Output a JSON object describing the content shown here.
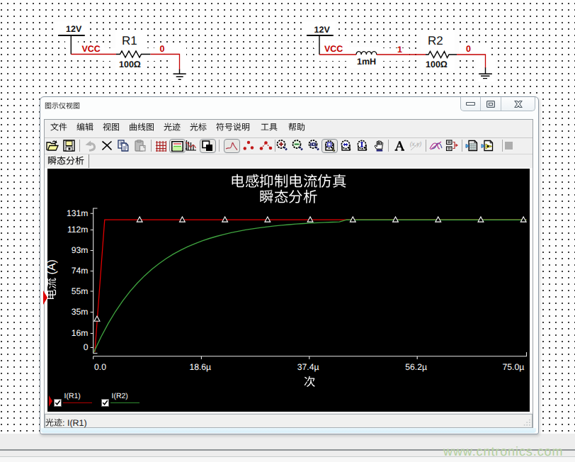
{
  "schematic": {
    "left": {
      "source_label": "12V",
      "net_vcc": "VCC",
      "refdes": "R1",
      "value": "100Ω",
      "net_out": "0"
    },
    "right": {
      "source_label": "12V",
      "net_vcc": "VCC",
      "inductor_value": "1mH",
      "net_mid": "1",
      "refdes": "R2",
      "value": "100Ω",
      "net_out": "0"
    }
  },
  "window": {
    "title": "图示仪视图",
    "controls": [
      {
        "name": "minimize"
      },
      {
        "name": "maximize"
      },
      {
        "name": "close"
      }
    ],
    "menu": [
      "文件",
      "编辑",
      "视图",
      "曲线图",
      "光迹",
      "光标",
      "符号说明",
      "工具",
      "帮助"
    ],
    "toolbar": [
      {
        "icon": "open",
        "sep": false
      },
      {
        "icon": "save",
        "sep": true
      },
      {
        "icon": "undo"
      },
      {
        "icon": "delete"
      },
      {
        "icon": "copy"
      },
      {
        "icon": "paste",
        "sep": true
      },
      {
        "icon": "grid"
      },
      {
        "icon": "legend",
        "pressed": true
      },
      {
        "icon": "traces"
      },
      {
        "icon": "bw",
        "pressed": true,
        "sep": true
      },
      {
        "icon": "curve",
        "pressed": true
      },
      {
        "icon": "dots"
      },
      {
        "icon": "dotline",
        "sep": true
      },
      {
        "icon": "zoomin"
      },
      {
        "icon": "zoomout"
      },
      {
        "icon": "zoom100"
      },
      {
        "icon": "zoomsel",
        "pressed": true
      },
      {
        "icon": "zoomh"
      },
      {
        "icon": "zoomv"
      },
      {
        "icon": "hand",
        "sep": true
      },
      {
        "icon": "text"
      },
      {
        "icon": "xy",
        "sep": true
      },
      {
        "icon": "overlay"
      },
      {
        "icon": "export",
        "sep": true
      },
      {
        "icon": "excel"
      },
      {
        "icon": "pagearrow",
        "sep": true
      },
      {
        "icon": "stop"
      }
    ],
    "tab": "瞬态分析",
    "statusbar": "光迹: I(R1)"
  },
  "chart_data": {
    "type": "line",
    "title": "电感抑制电流仿真",
    "subtitle": "瞬态分析",
    "xlabel": "次",
    "ylabel": "电流 (A)",
    "x_unit": "µs",
    "y_unit": "mA",
    "xlim": [
      0,
      75
    ],
    "ylim": [
      0,
      131.25
    ],
    "x_ticks": [
      "0.0",
      "18.6µ",
      "37.4µ",
      "56.2µ",
      "75.0µ"
    ],
    "y_ticks": [
      "0",
      "16m",
      "35m",
      "55m",
      "74m",
      "93m",
      "112m",
      "131m"
    ],
    "series": [
      {
        "name": "I(R1)",
        "color": "#e80000",
        "points": [
          [
            0.3,
            0
          ],
          [
            2.0,
            120.0
          ],
          [
            75.0,
            120.0
          ]
        ]
      },
      {
        "name": "I(R2)",
        "color": "#3fa33f",
        "points": [
          [
            0.12,
            0.0
          ],
          [
            1.37,
            13.84
          ],
          [
            2.62,
            26.08
          ],
          [
            3.87,
            36.92
          ],
          [
            5.12,
            46.5
          ],
          [
            6.37,
            54.98
          ],
          [
            7.62,
            62.48
          ],
          [
            8.87,
            69.11
          ],
          [
            10.12,
            74.98
          ],
          [
            11.37,
            80.17
          ],
          [
            12.62,
            84.77
          ],
          [
            13.87,
            88.83
          ],
          [
            15.12,
            92.43
          ],
          [
            16.37,
            95.61
          ],
          [
            17.62,
            98.42
          ],
          [
            18.87,
            100.91
          ],
          [
            20.12,
            103.11
          ],
          [
            21.37,
            105.06
          ],
          [
            22.62,
            106.78
          ],
          [
            23.87,
            108.31
          ],
          [
            25.12,
            109.65
          ],
          [
            26.37,
            110.85
          ],
          [
            27.62,
            111.9
          ],
          [
            28.87,
            112.84
          ],
          [
            30.12,
            113.66
          ],
          [
            31.37,
            114.39
          ],
          [
            32.62,
            115.04
          ],
          [
            33.87,
            115.61
          ],
          [
            35.12,
            116.12
          ],
          [
            36.37,
            116.57
          ],
          [
            37.62,
            116.96
          ],
          [
            38.87,
            117.31
          ],
          [
            40.12,
            117.62
          ],
          [
            41.37,
            117.9
          ],
          [
            42.62,
            118.14
          ],
          [
            43.87,
            120.0
          ],
          [
            45.12,
            120.0
          ],
          [
            46.37,
            120.0
          ],
          [
            47.62,
            120.0
          ],
          [
            48.87,
            120.0
          ],
          [
            50.12,
            120.0
          ],
          [
            51.37,
            120.0
          ],
          [
            52.62,
            120.0
          ],
          [
            53.87,
            120.0
          ],
          [
            55.12,
            120.0
          ],
          [
            56.37,
            120.0
          ],
          [
            57.62,
            120.0
          ],
          [
            58.87,
            120.0
          ],
          [
            60.12,
            120.0
          ],
          [
            61.37,
            120.0
          ],
          [
            62.62,
            120.0
          ],
          [
            63.87,
            120.0
          ],
          [
            65.12,
            120.0
          ],
          [
            66.37,
            120.0
          ],
          [
            67.62,
            120.0
          ],
          [
            68.87,
            120.0
          ],
          [
            70.12,
            120.0
          ],
          [
            71.37,
            120.0
          ],
          [
            72.62,
            120.0
          ],
          [
            73.87,
            120.0
          ],
          [
            75.0,
            120.0
          ]
        ]
      }
    ],
    "markers": [
      [
        0.67,
        30.0
      ],
      [
        8.05,
        120.0
      ],
      [
        15.43,
        120.0
      ],
      [
        22.81,
        120.0
      ],
      [
        30.19,
        120.0
      ],
      [
        37.57,
        120.0
      ],
      [
        44.95,
        120.0
      ],
      [
        52.33,
        120.0
      ],
      [
        59.71,
        120.0
      ],
      [
        67.09,
        120.0
      ],
      [
        74.47,
        120.0
      ]
    ],
    "legend": [
      {
        "label": "I(R1)",
        "color": "#b40000",
        "checked": true
      },
      {
        "label": "I(R2)",
        "color": "#2f8c2f",
        "checked": true
      }
    ]
  },
  "watermark": "www.cntronics.com"
}
